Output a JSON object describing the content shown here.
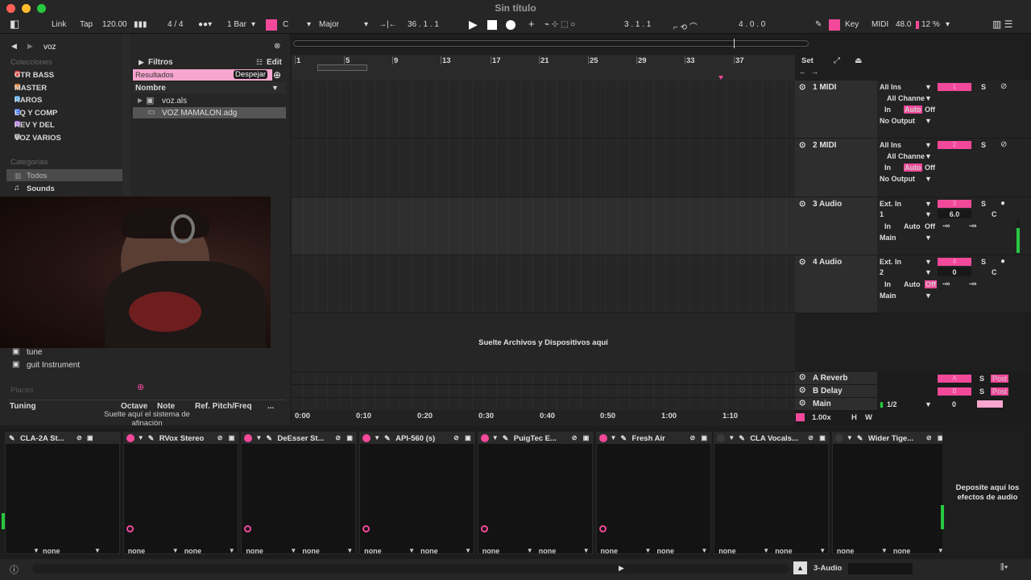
{
  "window": {
    "title": "Sin título"
  },
  "control_bar": {
    "link": "Link",
    "tap": "Tap",
    "tempo": "120.00",
    "signature": "4 / 4",
    "quantize": "1 Bar",
    "key_root": "C",
    "scale": "Major",
    "position": "36 .  1 .  1",
    "loop_start": "3 .  1 .  1",
    "loop_length": "4 .  0 .  0",
    "key_label": "Key",
    "midi_label": "MIDI",
    "midi_value": "48.0",
    "cpu": "12 %"
  },
  "browser": {
    "search": "voz",
    "collections_label": "Colecciones",
    "collections": [
      {
        "name": "GTR BASS",
        "color": "#e04040"
      },
      {
        "name": "MASTER",
        "color": "#e07a30"
      },
      {
        "name": "RAROS",
        "color": "#3aa0e8"
      },
      {
        "name": "EQ Y COMP",
        "color": "#3a6ee8"
      },
      {
        "name": "REV Y DEL",
        "color": "#a060e0"
      },
      {
        "name": "VOZ VARIOS",
        "color": "#909090"
      }
    ],
    "categories_label": "Categorías",
    "categories": [
      "Todos",
      "Sounds"
    ],
    "filters": "Filtros",
    "edit": "Edit",
    "results": "Resultados",
    "clear": "Despejar",
    "name_header": "Nombre",
    "results_list": [
      "voz.als",
      "VOZ MAMALON.adg"
    ],
    "lower_items": [
      "tune",
      "guit Instrument"
    ],
    "places": "Places",
    "tuning": {
      "label": "Tuning",
      "octave": "Octave",
      "note": "Note",
      "ref": "Ref. Pitch/Freq",
      "more": "...",
      "hint": "Suelte aquí el sistema de afinación"
    }
  },
  "arrangement": {
    "ruler": [
      "1",
      "5",
      "9",
      "13",
      "17",
      "21",
      "25",
      "29",
      "33",
      "37"
    ],
    "time_ruler": [
      "0:00",
      "0:10",
      "0:20",
      "0:30",
      "0:40",
      "0:50",
      "1:00",
      "1:10"
    ],
    "drop_hint": "Suelte Archivos y Dispositivos aquí",
    "zoom": "1.00x",
    "h": "H",
    "w": "W",
    "set": "Set"
  },
  "tracks": [
    {
      "name": "1 MIDI",
      "input": "All Ins",
      "channel": "All Channe",
      "monitor": [
        "In",
        "Auto",
        "Off"
      ],
      "output": "No Output",
      "number": "1",
      "solo": "S"
    },
    {
      "name": "2 MIDI",
      "input": "All Ins",
      "channel": "All Channe",
      "monitor": [
        "In",
        "Auto",
        "Off"
      ],
      "output": "No Output",
      "number": "2",
      "solo": "S"
    },
    {
      "name": "3 Audio",
      "input": "Ext. In",
      "channel": "1",
      "monitor": [
        "In",
        "Auto",
        "Off"
      ],
      "output": "Main",
      "number": "3",
      "solo": "S",
      "vol": "6.0",
      "pan": "C",
      "sends": [
        "-∞",
        "-∞"
      ]
    },
    {
      "name": "4 Audio",
      "input": "Ext. In",
      "channel": "2",
      "monitor": [
        "In",
        "Auto",
        "Off"
      ],
      "output": "Main",
      "number": "4",
      "solo": "S",
      "vol": "0",
      "pan": "C",
      "sends": [
        "-∞",
        "-∞"
      ]
    }
  ],
  "returns": [
    {
      "name": "A Reverb",
      "number": "A",
      "solo": "S",
      "post": "Post"
    },
    {
      "name": "B Delay",
      "number": "B",
      "solo": "S",
      "post": "Post"
    }
  ],
  "main": {
    "name": "Main",
    "cue": "1/2",
    "vol": "0"
  },
  "devices": [
    {
      "name": "CLA-2A St...",
      "l": "none",
      "r": ""
    },
    {
      "name": "RVox Stereo",
      "l": "none",
      "r": "none"
    },
    {
      "name": "DeEsser St...",
      "l": "none",
      "r": "none"
    },
    {
      "name": "API-560 (s)",
      "l": "none",
      "r": "none"
    },
    {
      "name": "PuigTec E...",
      "l": "none",
      "r": "none"
    },
    {
      "name": "Fresh Air",
      "l": "none",
      "r": "none"
    },
    {
      "name": "CLA Vocals...",
      "l": "none",
      "r": "none"
    },
    {
      "name": "Wider Tige...",
      "l": "none",
      "r": "none"
    }
  ],
  "device_drop": "Deposite aquí los efectos de audio",
  "status": {
    "track": "3-Audio"
  }
}
